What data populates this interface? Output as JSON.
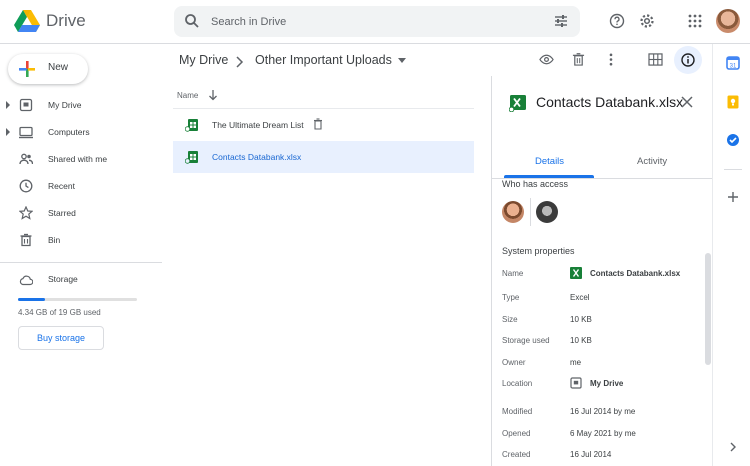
{
  "header": {
    "brand": "Drive",
    "search_placeholder": "Search in Drive"
  },
  "sidebar": {
    "new_label": "New",
    "items": [
      {
        "label": "My Drive",
        "icon": "my-drive-icon",
        "expandable": true
      },
      {
        "label": "Computers",
        "icon": "computer-icon",
        "expandable": true
      },
      {
        "label": "Shared with me",
        "icon": "people-icon",
        "expandable": false
      },
      {
        "label": "Recent",
        "icon": "clock-icon",
        "expandable": false
      },
      {
        "label": "Starred",
        "icon": "star-icon",
        "expandable": false
      },
      {
        "label": "Bin",
        "icon": "bin-icon",
        "expandable": false
      }
    ],
    "storage_label": "Storage",
    "storage_used_text": "4.34 GB of 19 GB used",
    "storage_fraction": 0.228,
    "buy_storage_label": "Buy storage"
  },
  "main": {
    "breadcrumb": [
      "My Drive",
      "Other Important Uploads"
    ],
    "column_name": "Name",
    "files": [
      {
        "name": "The Ultimate Dream List",
        "icon": "sheets-shared-icon",
        "trashed_icon": true,
        "selected": false
      },
      {
        "name": "Contacts Databank.xlsx",
        "icon": "sheets-shared-icon",
        "trashed_icon": false,
        "selected": true
      }
    ]
  },
  "details": {
    "title": "Contacts Databank.xlsx",
    "tabs": [
      "Details",
      "Activity"
    ],
    "active_tab": "Details",
    "who_has_access": "Who has access",
    "system_properties": "System properties",
    "properties": [
      {
        "label": "Name",
        "value": "Contacts Databank.xlsx"
      },
      {
        "label": "Type",
        "value": "Excel"
      },
      {
        "label": "Size",
        "value": "10 KB"
      },
      {
        "label": "Storage used",
        "value": "10 KB"
      },
      {
        "label": "Owner",
        "value": "me"
      },
      {
        "label": "Location",
        "value": "My Drive"
      },
      {
        "label": "Modified",
        "value": "16 Jul 2014 by me"
      },
      {
        "label": "Opened",
        "value": "6 May 2021 by me"
      },
      {
        "label": "Created",
        "value": "16 Jul 2014"
      }
    ]
  },
  "colors": {
    "accent": "#1a73e8",
    "selected_row": "#e8f0fe",
    "sheets_green": "#188038"
  }
}
